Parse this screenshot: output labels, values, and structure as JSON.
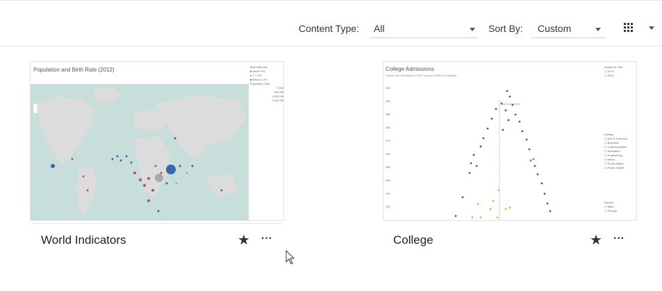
{
  "toolbar": {
    "content_type_label": "Content Type:",
    "content_type_value": "All",
    "sort_by_label": "Sort By:",
    "sort_by_value": "Custom"
  },
  "cards": [
    {
      "title": "World Indicators",
      "thumbnail": {
        "title": "Population and Birth Rate (2012)",
        "legend_title": "Birth Rate Bin",
        "legend_items": [
          "Above 3%",
          "1.7–3%",
          "Below 1.3%"
        ],
        "legend_colors": [
          "#c0504d",
          "#a9a9a9",
          "#3a66a8"
        ],
        "size_title": "Population Total",
        "size_items": [
          "0.0M",
          "640.0M",
          "1,000.0M",
          "1,162.7M"
        ]
      }
    },
    {
      "title": "College",
      "thumbnail": {
        "title": "College Admissions",
        "subtitle": "Explore the distribution of SAT scores in different colleges",
        "reference_label": "Avg Score 2013",
        "filter1_title": "Academic Year",
        "filter1_items": [
          "2013",
          "2014"
        ],
        "filter2_title": "College",
        "filter2_items": [
          "Arts & Sciences",
          "Business",
          "Communication",
          "Education",
          "Engineering",
          "Music",
          "Public Affairs",
          "Public Health"
        ],
        "filter3_title": "Gender",
        "filter3_items": [
          "Male",
          "Female"
        ],
        "y_ticks": [
          "304",
          "296",
          "288",
          "280",
          "272",
          "264",
          "256",
          "248",
          "240",
          "232"
        ]
      }
    }
  ],
  "colors": {
    "map_land": "#d9d9d9",
    "map_water": "#c8dedb",
    "accent_blue": "#3a66a8",
    "accent_red": "#c0504d",
    "accent_orange": "#f2a93b"
  },
  "icons": {
    "view": "grid-view-icon",
    "favorite": "star-icon",
    "more": "more-actions-icon",
    "pointer": "mouse-cursor-icon"
  }
}
